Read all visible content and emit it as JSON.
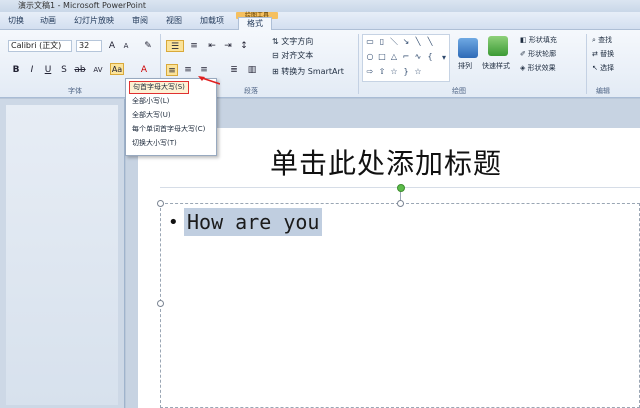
{
  "window": {
    "title": "演示文稿1 - Microsoft PowerPoint"
  },
  "tabs": [
    {
      "label": "切换"
    },
    {
      "label": "动画"
    },
    {
      "label": "幻灯片放映"
    },
    {
      "label": "审阅"
    },
    {
      "label": "视图"
    },
    {
      "label": "加载项"
    },
    {
      "label": "格式"
    }
  ],
  "context_tab": {
    "label": "绘图工具"
  },
  "ribbon": {
    "font_name": "Calibri (正文)",
    "font_size": "32",
    "font_group_label": "字体",
    "paragraph_group_label": "段落",
    "drawing_group_label": "绘图",
    "editing_group_label": "编辑",
    "text_direction": "文字方向",
    "align_text": "对齐文本",
    "convert_smartart": "转换为 SmartArt",
    "arrange": "排列",
    "quick_styles": "快速样式",
    "shape_fill": "形状填充",
    "shape_outline": "形状轮廓",
    "shape_effects": "形状效果",
    "find": "查找",
    "replace": "替换",
    "select": "选择"
  },
  "change_case_menu": {
    "items": [
      {
        "label": "句首字母大写(S)"
      },
      {
        "label": "全部小写(L)"
      },
      {
        "label": "全部大写(U)"
      },
      {
        "label": "每个单词首字母大写(C)"
      },
      {
        "label": "切换大小写(T)"
      }
    ]
  },
  "slide": {
    "title_placeholder": "单击此处添加标题",
    "bullet": "•",
    "body_text": "How are you"
  }
}
